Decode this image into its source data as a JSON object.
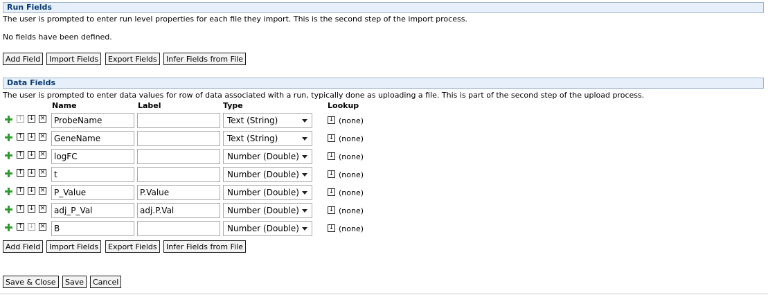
{
  "run_fields": {
    "title": "Run Fields",
    "description": "The user is prompted to enter run level properties for each file they import. This is the second step of the import process.",
    "empty_message": "No fields have been defined.",
    "buttons": {
      "add": "Add Field",
      "import": "Import Fields",
      "export": "Export Fields",
      "infer": "Infer Fields from File"
    }
  },
  "data_fields": {
    "title": "Data Fields",
    "description": "The user is prompted to enter data values for row of data associated with a run, typically done as uploading a file. This is part of the second step of the upload process.",
    "columns": {
      "name": "Name",
      "label": "Label",
      "type": "Type",
      "lookup": "Lookup"
    },
    "rows": [
      {
        "name": "ProbeName",
        "label": "",
        "type": "Text (String)",
        "lookup": "(none)",
        "up_enabled": false,
        "down_enabled": true
      },
      {
        "name": "GeneName",
        "label": "",
        "type": "Text (String)",
        "lookup": "(none)",
        "up_enabled": true,
        "down_enabled": true
      },
      {
        "name": "logFC",
        "label": "",
        "type": "Number (Double)",
        "lookup": "(none)",
        "up_enabled": true,
        "down_enabled": true
      },
      {
        "name": "t",
        "label": "",
        "type": "Number (Double)",
        "lookup": "(none)",
        "up_enabled": true,
        "down_enabled": true
      },
      {
        "name": "P_Value",
        "label": "P.Value",
        "type": "Number (Double)",
        "lookup": "(none)",
        "up_enabled": true,
        "down_enabled": true
      },
      {
        "name": "adj_P_Val",
        "label": "adj.P.Val",
        "type": "Number (Double)",
        "lookup": "(none)",
        "up_enabled": true,
        "down_enabled": true
      },
      {
        "name": "B",
        "label": "",
        "type": "Number (Double)",
        "lookup": "(none)",
        "up_enabled": true,
        "down_enabled": false
      }
    ],
    "buttons": {
      "add": "Add Field",
      "import": "Import Fields",
      "export": "Export Fields",
      "infer": "Infer Fields from File"
    }
  },
  "footer": {
    "save_close": "Save & Close",
    "save": "Save",
    "cancel": "Cancel"
  },
  "colors": {
    "header_bg": "#e6effa",
    "header_text": "#0a3a73",
    "plus_green": "#2e9b2e"
  }
}
